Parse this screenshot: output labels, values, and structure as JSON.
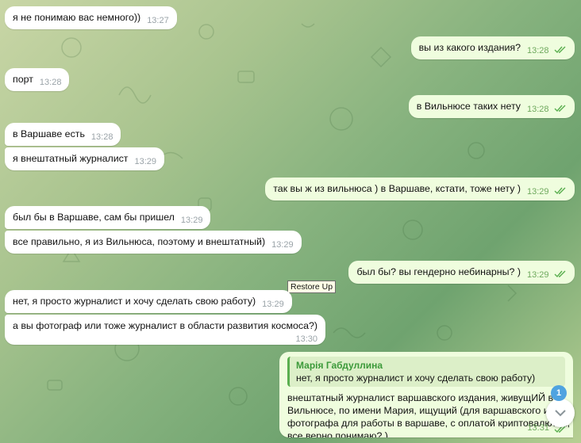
{
  "chat": {
    "messages": [
      {
        "text": "я не понимаю вас немного))",
        "time": "13:27"
      },
      {
        "text": "вы из какого издания?",
        "time": "13:28"
      },
      {
        "text": "порт",
        "time": "13:28"
      },
      {
        "text": "в Вильнюсе таких нету",
        "time": "13:28"
      },
      {
        "text": "в Варшаве есть",
        "time": "13:28"
      },
      {
        "text": "я внештатный журналист",
        "time": "13:29"
      },
      {
        "text": "так вы ж из вильнюса ) в Варшаве, кстати, тоже нету )",
        "time": "13:29"
      },
      {
        "text": "был бы в Варшаве, сам бы пришел",
        "time": "13:29"
      },
      {
        "text": "все правильно, я из Вильнюса, поэтому и внештатный)",
        "time": "13:29"
      },
      {
        "text": "был бы? вы гендерно небинарны? )",
        "time": "13:29"
      },
      {
        "text": "нет, я просто журналист и хочу сделать свою работу)",
        "time": "13:29"
      },
      {
        "text": "а вы фотограф или тоже журналист в области развития космоса?)",
        "time": "13:30"
      }
    ],
    "reply": {
      "quote_author": "Марія Габдуллина",
      "quote_text": "нет, я просто журналист и хочу сделать свою работу)",
      "lines": [
        "внештатный журналист варшавского издания, живущИЙ в",
        "Вильнюсе, по имени Мария, ищущий (для варшавского издания",
        "фотографа для работы в варшаве, с оплатой криптовалютой,",
        "все верно понимаю? )"
      ],
      "time": "13:31"
    },
    "tooltip": "Restore Up",
    "unread_badge": "1",
    "icons": {
      "read_receipt": "double-check-icon",
      "scroll": "chevron-down-icon"
    },
    "colors": {
      "incoming": "#ffffff",
      "outgoing": "#effdde",
      "accent": "#5aaf4f",
      "badge": "#4fa3e0"
    }
  }
}
